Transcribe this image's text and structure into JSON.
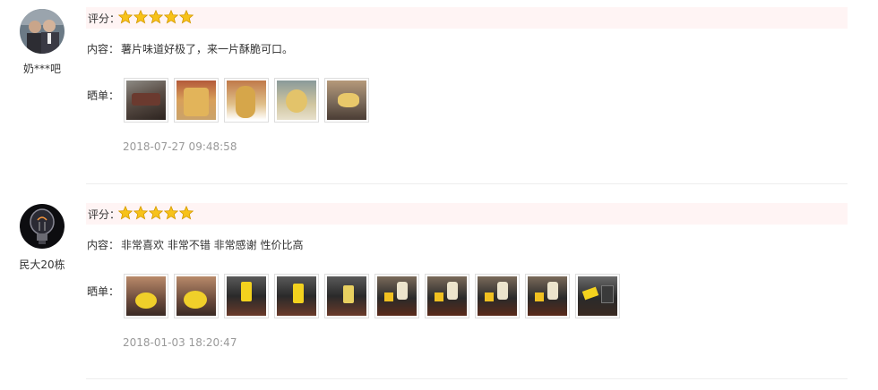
{
  "reviews": [
    {
      "username": "奶***吧",
      "rating_label": "评分：",
      "rating": 5,
      "content_label": "内容：",
      "content": "薯片味道好极了，来一片酥脆可口。",
      "show_label": "晒单：",
      "photos": [
        "photo-1",
        "photo-2",
        "photo-3",
        "photo-4",
        "photo-5"
      ],
      "date": "2018-07-27 09:48:58"
    },
    {
      "username": "民大20栋",
      "rating_label": "评分：",
      "rating": 5,
      "content_label": "内容：",
      "content": "非常喜欢 非常不错 非常感谢 性价比高",
      "show_label": "晒单：",
      "photos": [
        "photo-1",
        "photo-2",
        "photo-3",
        "photo-4",
        "photo-5",
        "photo-6",
        "photo-7",
        "photo-8",
        "photo-9",
        "photo-10"
      ],
      "date": "2018-01-03 18:20:47"
    }
  ],
  "colors": {
    "rating_bg": "#fff4f4",
    "star_fill": "#f7c21a",
    "date_text": "#999999"
  }
}
